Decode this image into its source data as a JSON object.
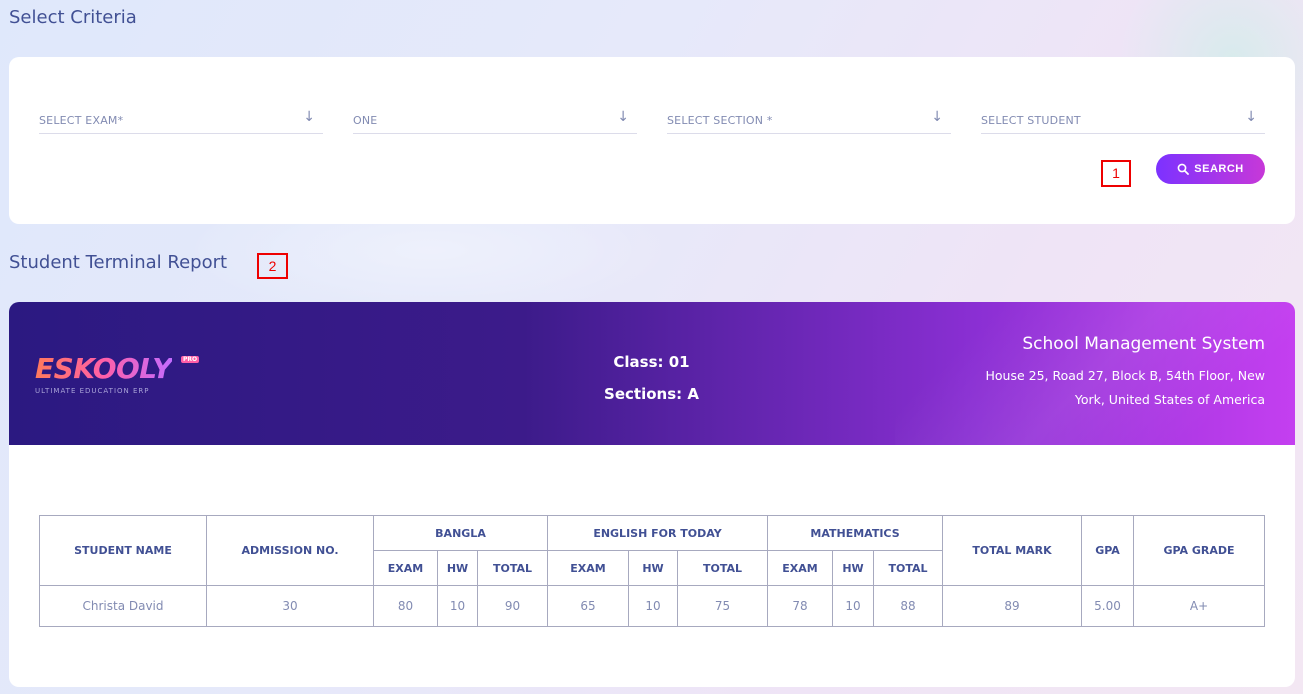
{
  "criteria": {
    "title": "Select Criteria",
    "selects": [
      {
        "label": "SELECT EXAM*"
      },
      {
        "label": "ONE"
      },
      {
        "label": "SELECT SECTION *"
      },
      {
        "label": "SELECT STUDENT"
      }
    ],
    "search_label": "SEARCH"
  },
  "markers": [
    "1",
    "2"
  ],
  "report": {
    "title": "Student Terminal Report",
    "logo_text": "ESKOOLY",
    "logo_badge": "PRO",
    "logo_tagline": "ULTIMATE EDUCATION ERP",
    "class_label": "Class: 01",
    "section_label": "Sections: A",
    "school_name": "School Management System",
    "school_address_line1": "House 25, Road 27, Block B, 54th Floor, New",
    "school_address_line2": "York, United States of America"
  },
  "table": {
    "headers": {
      "student_name": "STUDENT NAME",
      "admission_no": "ADMISSION NO.",
      "subjects": [
        "BANGLA",
        "ENGLISH FOR TODAY",
        "MATHEMATICS"
      ],
      "sub": {
        "exam": "EXAM",
        "hw": "HW",
        "total": "TOTAL"
      },
      "total_mark": "TOTAL MARK",
      "gpa": "GPA",
      "gpa_grade": "GPA GRADE"
    },
    "rows": [
      {
        "name": "Christa David",
        "admission": "30",
        "bangla": {
          "exam": "80",
          "hw": "10",
          "total": "90"
        },
        "english": {
          "exam": "65",
          "hw": "10",
          "total": "75"
        },
        "math": {
          "exam": "78",
          "hw": "10",
          "total": "88"
        },
        "total_mark": "89",
        "gpa": "5.00",
        "grade": "A+"
      }
    ]
  },
  "colors": {
    "accent_start": "#7c32ff",
    "accent_end": "#c738d8",
    "text_primary": "#415094",
    "marker": "#e00000"
  }
}
